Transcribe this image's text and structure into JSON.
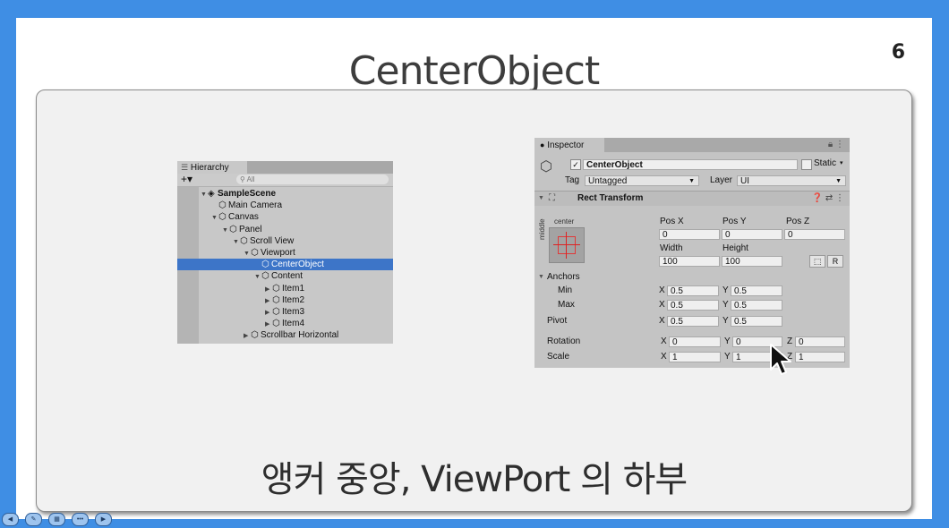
{
  "slide": {
    "title": "CenterObject",
    "page_number": "6",
    "caption": "앵커 중앙, ViewPort 의 하부"
  },
  "hierarchy": {
    "tab_label": "Hierarchy",
    "search_placeholder": "All",
    "add_label": "+▾",
    "items": [
      {
        "label": "SampleScene",
        "level": 0,
        "expanded": true,
        "bold": true,
        "selected": false,
        "icon": "unity-scene-icon"
      },
      {
        "label": "Main Camera",
        "level": 1,
        "expanded": null,
        "bold": false,
        "selected": false,
        "icon": "cube-icon"
      },
      {
        "label": "Canvas",
        "level": 1,
        "expanded": true,
        "bold": false,
        "selected": false,
        "icon": "cube-icon"
      },
      {
        "label": "Panel",
        "level": 2,
        "expanded": true,
        "bold": false,
        "selected": false,
        "icon": "cube-icon"
      },
      {
        "label": "Scroll View",
        "level": 3,
        "expanded": true,
        "bold": false,
        "selected": false,
        "icon": "cube-icon"
      },
      {
        "label": "Viewport",
        "level": 4,
        "expanded": true,
        "bold": false,
        "selected": false,
        "icon": "cube-icon"
      },
      {
        "label": "CenterObject",
        "level": 5,
        "expanded": null,
        "bold": false,
        "selected": true,
        "icon": "cube-icon"
      },
      {
        "label": "Content",
        "level": 5,
        "expanded": true,
        "bold": false,
        "selected": false,
        "icon": "cube-icon"
      },
      {
        "label": "Item1",
        "level": 6,
        "expanded": false,
        "bold": false,
        "selected": false,
        "icon": "cube-icon"
      },
      {
        "label": "Item2",
        "level": 6,
        "expanded": false,
        "bold": false,
        "selected": false,
        "icon": "cube-icon"
      },
      {
        "label": "Item3",
        "level": 6,
        "expanded": false,
        "bold": false,
        "selected": false,
        "icon": "cube-icon"
      },
      {
        "label": "Item4",
        "level": 6,
        "expanded": false,
        "bold": false,
        "selected": false,
        "icon": "cube-icon"
      },
      {
        "label": "Scrollbar Horizontal",
        "level": 4,
        "expanded": false,
        "bold": false,
        "selected": false,
        "icon": "cube-icon"
      }
    ]
  },
  "inspector": {
    "tab_label": "Inspector",
    "object_name": "CenterObject",
    "active_checked": true,
    "static_label": "Static",
    "tag_label": "Tag",
    "tag_value": "Untagged",
    "layer_label": "Layer",
    "layer_value": "UI",
    "component_title": "Rect Transform",
    "anchor_preset_top": "center",
    "anchor_preset_side": "middle",
    "pos_x_label": "Pos X",
    "pos_y_label": "Pos Y",
    "pos_z_label": "Pos Z",
    "pos_x": "0",
    "pos_y": "0",
    "pos_z": "0",
    "width_label": "Width",
    "height_label": "Height",
    "width": "100",
    "height": "100",
    "raw_edit_label": "R",
    "anchors_label": "Anchors",
    "min_label": "Min",
    "max_label": "Max",
    "pivot_label": "Pivot",
    "rotation_label": "Rotation",
    "scale_label": "Scale",
    "axis_x": "X",
    "axis_y": "Y",
    "axis_z": "Z",
    "min_x": "0.5",
    "min_y": "0.5",
    "max_x": "0.5",
    "max_y": "0.5",
    "pivot_x": "0.5",
    "pivot_y": "0.5",
    "rot_x": "0",
    "rot_y": "0",
    "rot_z": "0",
    "scale_x": "1",
    "scale_y": "1",
    "scale_z": "1"
  },
  "colors": {
    "background_blue": "#3f8ee4",
    "selection_blue": "#3d75c8"
  }
}
